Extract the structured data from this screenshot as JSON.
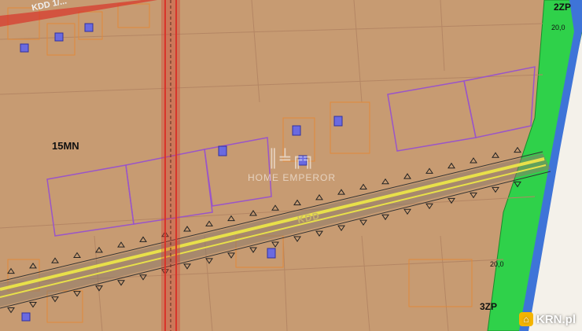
{
  "map": {
    "zones": {
      "residential": "15MN",
      "green_north": "2ZP",
      "green_south": "3ZP"
    },
    "dimensions": {
      "top": "20,0",
      "bottom": "20,0"
    },
    "road_labels": {
      "main": "KDD",
      "top": "KDD 1/..."
    },
    "watermark": {
      "mark": "║╧╔╗",
      "text": "HOME EMPEROR"
    },
    "brand": {
      "icon": "house-icon",
      "text": "KRN.pl"
    }
  },
  "colors": {
    "ground": "#c79b72",
    "green_zone": "#2fd14a",
    "blue_band": "#3e74d8",
    "road_yellow": "#e8e04a",
    "pipeline_red": "#d8342a",
    "parcel_purple": "#9a55c8"
  }
}
